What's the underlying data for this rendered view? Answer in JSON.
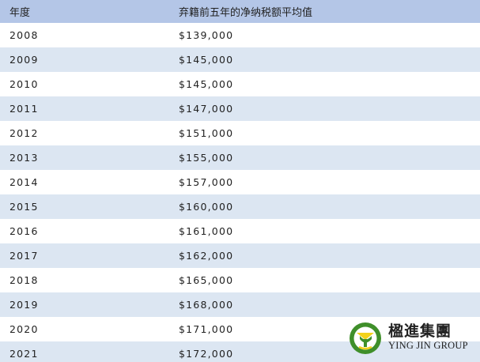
{
  "table": {
    "header": {
      "year": "年度",
      "value": "弃籍前五年的净纳税额平均值"
    },
    "rows": [
      {
        "year": "2008",
        "value": "$139,000"
      },
      {
        "year": "2009",
        "value": "$145,000"
      },
      {
        "year": "2010",
        "value": "$145,000"
      },
      {
        "year": "2011",
        "value": "$147,000"
      },
      {
        "year": "2012",
        "value": "$151,000"
      },
      {
        "year": "2013",
        "value": "$155,000"
      },
      {
        "year": "2014",
        "value": "$157,000"
      },
      {
        "year": "2015",
        "value": "$160,000"
      },
      {
        "year": "2016",
        "value": "$161,000"
      },
      {
        "year": "2017",
        "value": "$162,000"
      },
      {
        "year": "2018",
        "value": "$165,000"
      },
      {
        "year": "2019",
        "value": "$168,000"
      },
      {
        "year": "2020",
        "value": "$171,000"
      },
      {
        "year": "2021",
        "value": "$172,000"
      }
    ]
  },
  "logo": {
    "name_cn": "楹進集團",
    "name_en": "YING JIN GROUP",
    "icon": "yj-emblem-icon",
    "colors": {
      "green": "#3f8f2a",
      "yellow": "#f2d21b"
    }
  },
  "colors": {
    "header_bg": "#b4c6e7",
    "stripe_bg": "#dce6f2"
  }
}
